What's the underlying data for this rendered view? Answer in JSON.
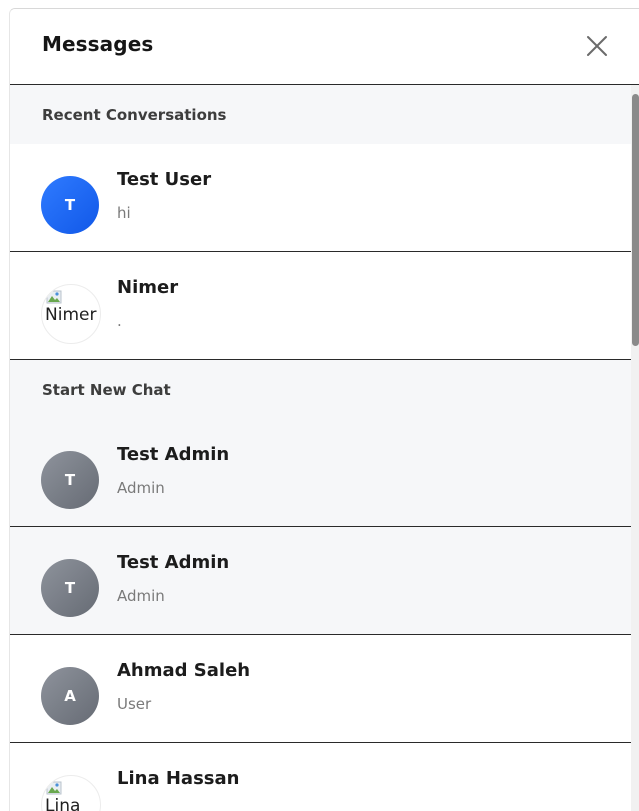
{
  "header": {
    "title": "Messages"
  },
  "sections": {
    "recent": "Recent Conversations",
    "new_chat": "Start New Chat"
  },
  "recent": [
    {
      "initial": "T",
      "name": "Test User",
      "subtitle": "hi"
    },
    {
      "avatar_alt": "Nimer",
      "name": "Nimer",
      "subtitle": "."
    }
  ],
  "contacts": [
    {
      "initial": "T",
      "name": "Test Admin",
      "subtitle": "Admin"
    },
    {
      "initial": "T",
      "name": "Test Admin",
      "subtitle": "Admin"
    },
    {
      "initial": "A",
      "name": "Ahmad Saleh",
      "subtitle": "User"
    },
    {
      "avatar_alt": "Lina",
      "name": "Lina Hassan",
      "subtitle": ""
    }
  ],
  "icons": {
    "close": "close-icon",
    "broken_image": "broken-image-icon"
  },
  "colors": {
    "accent": "#1f6bff",
    "avatar_gray": "#7b8089"
  }
}
